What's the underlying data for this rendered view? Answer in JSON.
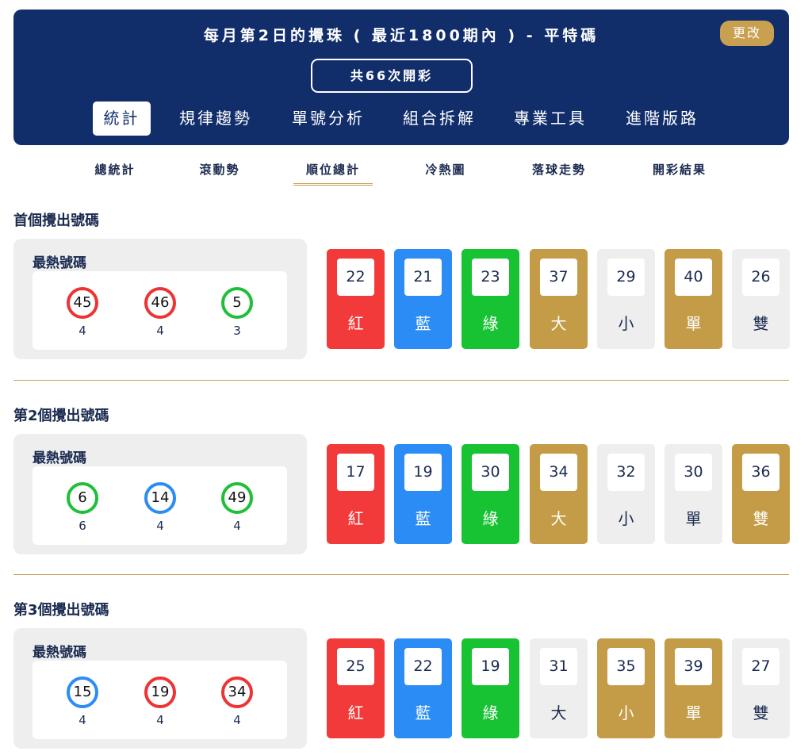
{
  "header": {
    "title": "每月第2日的攪珠 ( 最近1800期內 ) - 平特碼",
    "change_button": "更改",
    "draw_count": "共66次開彩"
  },
  "main_tabs": [
    "統計",
    "規律趨勢",
    "單號分析",
    "組合拆解",
    "專業工具",
    "進階版路"
  ],
  "sub_tabs": [
    "總統計",
    "滾動勢",
    "順位總計",
    "冷熱圖",
    "落球走勢",
    "開彩結果"
  ],
  "hot_label": "最熱號碼",
  "sections": [
    {
      "title": "首個攪出號碼",
      "hot_numbers": [
        {
          "number": "45",
          "count": "4",
          "color": "red"
        },
        {
          "number": "46",
          "count": "4",
          "color": "red"
        },
        {
          "number": "5",
          "count": "3",
          "color": "green"
        }
      ],
      "stats": [
        {
          "value": "22",
          "label": "紅",
          "style": "red"
        },
        {
          "value": "21",
          "label": "藍",
          "style": "blue"
        },
        {
          "value": "23",
          "label": "綠",
          "style": "green"
        },
        {
          "value": "37",
          "label": "大",
          "style": "gold"
        },
        {
          "value": "29",
          "label": "小",
          "style": "gray"
        },
        {
          "value": "40",
          "label": "單",
          "style": "gold"
        },
        {
          "value": "26",
          "label": "雙",
          "style": "gray"
        }
      ]
    },
    {
      "title": "第2個攪出號碼",
      "hot_numbers": [
        {
          "number": "6",
          "count": "6",
          "color": "green"
        },
        {
          "number": "14",
          "count": "4",
          "color": "blue"
        },
        {
          "number": "49",
          "count": "4",
          "color": "green"
        }
      ],
      "stats": [
        {
          "value": "17",
          "label": "紅",
          "style": "red"
        },
        {
          "value": "19",
          "label": "藍",
          "style": "blue"
        },
        {
          "value": "30",
          "label": "綠",
          "style": "green"
        },
        {
          "value": "34",
          "label": "大",
          "style": "gold"
        },
        {
          "value": "32",
          "label": "小",
          "style": "gray"
        },
        {
          "value": "30",
          "label": "單",
          "style": "gray"
        },
        {
          "value": "36",
          "label": "雙",
          "style": "gold"
        }
      ]
    },
    {
      "title": "第3個攪出號碼",
      "hot_numbers": [
        {
          "number": "15",
          "count": "4",
          "color": "blue"
        },
        {
          "number": "19",
          "count": "4",
          "color": "red"
        },
        {
          "number": "34",
          "count": "4",
          "color": "red"
        }
      ],
      "stats": [
        {
          "value": "25",
          "label": "紅",
          "style": "red"
        },
        {
          "value": "22",
          "label": "藍",
          "style": "blue"
        },
        {
          "value": "19",
          "label": "綠",
          "style": "green"
        },
        {
          "value": "31",
          "label": "大",
          "style": "gray"
        },
        {
          "value": "35",
          "label": "小",
          "style": "gold"
        },
        {
          "value": "39",
          "label": "單",
          "style": "gold"
        },
        {
          "value": "27",
          "label": "雙",
          "style": "gray"
        }
      ]
    }
  ]
}
